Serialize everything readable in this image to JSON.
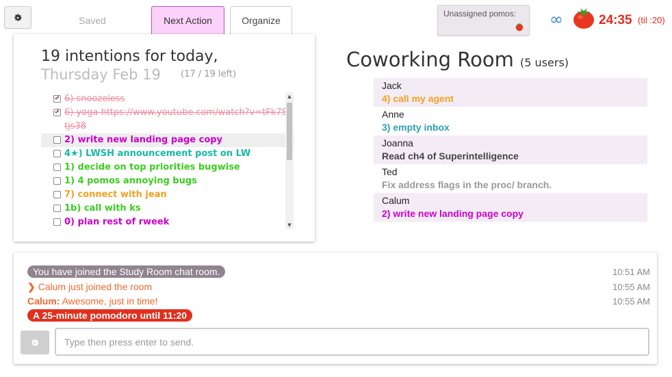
{
  "topbar": {
    "tabs": {
      "saved": "Saved",
      "next_action": "Next Action",
      "organize": "Organize"
    },
    "unassigned_label": "Unassigned pomos:",
    "infinity": "∞",
    "timer": "24:35",
    "til": "(til :20)"
  },
  "intentions": {
    "title": "19 intentions for today,",
    "date": "Thursday Feb 19",
    "left": "(17 / 19 left)",
    "items": [
      {
        "text": "6) snoozeless",
        "done": true,
        "color": "#f08a9d"
      },
      {
        "text": "6) yoga https://www.youtube.com/watch?v=tFk7SVtjs38",
        "done": true,
        "color": "#f08a9d"
      },
      {
        "text": "2) write new landing page copy",
        "done": false,
        "color": "#cc00cc"
      },
      {
        "text": "4★) LWSH announcement post on LW",
        "done": false,
        "color": "#17b8a6"
      },
      {
        "text": "1) decide on top priorities bugwise",
        "done": false,
        "color": "#3ccd1f"
      },
      {
        "text": "1) 4 pomos annoying bugs",
        "done": false,
        "color": "#3ccd1f"
      },
      {
        "text": "7) connect with jean",
        "done": false,
        "color": "#f0a020"
      },
      {
        "text": "1b) call with ks",
        "done": false,
        "color": "#3ccd1f"
      },
      {
        "text": "0) plan rest of rweek",
        "done": false,
        "color": "#cc00cc"
      }
    ]
  },
  "coworking": {
    "title": "Coworking Room",
    "users_count": "(5 users)",
    "users": [
      {
        "name": "Jack",
        "task": "4) call my agent",
        "color": "#f5a020"
      },
      {
        "name": "Anne",
        "task": "3) empty inbox",
        "color": "#2a9fb5"
      },
      {
        "name": "Joanna",
        "task": "Read ch4 of Superintelligence",
        "color": "#444444"
      },
      {
        "name": "Ted",
        "task": "Fix address flags in the proc/ branch.",
        "color": "#999999"
      },
      {
        "name": "Calum",
        "task": "2) write new landing page copy",
        "color": "#cc00cc"
      }
    ]
  },
  "chat": {
    "messages": [
      {
        "text": "You have joined the Study Room chat room.",
        "time": "10:51 AM"
      },
      {
        "text": "Calum just joined the room",
        "time": "10:55 AM"
      },
      {
        "author": "Calum:",
        "text": "Awesome, just in time!",
        "time": "10:55 AM"
      },
      {
        "text": "A 25-minute pomodoro until 11:20"
      }
    ],
    "placeholder": "Type then press enter to send."
  },
  "colors": {
    "accent_pink": "#fbd2fa",
    "timer_red": "#e02d1f",
    "chat_orange": "#f0682f"
  }
}
